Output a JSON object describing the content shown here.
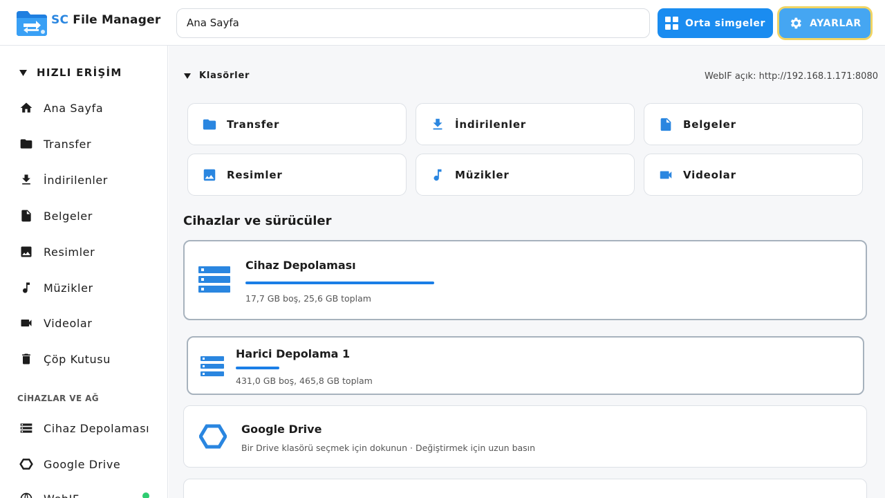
{
  "app": {
    "title_prefix": "SC",
    "title_rest": "File Manager"
  },
  "header": {
    "path": "Ana Sayfa",
    "view_button": "Orta simgeler",
    "settings_button": "AYARLAR"
  },
  "sidebar": {
    "quick_access_title": "HIZLI ERİŞİM",
    "items": [
      {
        "label": "Ana Sayfa",
        "icon": "home-icon"
      },
      {
        "label": "Transfer",
        "icon": "folder-icon"
      },
      {
        "label": "İndirilenler",
        "icon": "download-icon"
      },
      {
        "label": "Belgeler",
        "icon": "document-icon"
      },
      {
        "label": "Resimler",
        "icon": "image-icon"
      },
      {
        "label": "Müzikler",
        "icon": "music-icon"
      },
      {
        "label": "Videolar",
        "icon": "video-icon"
      },
      {
        "label": "Çöp Kutusu",
        "icon": "trash-icon"
      }
    ],
    "devices_title": "CİHAZLAR VE AĞ",
    "device_items": [
      {
        "label": "Cihaz Depolaması",
        "icon": "storage-icon"
      },
      {
        "label": "Google Drive",
        "icon": "drive-icon"
      },
      {
        "label": "WebIF",
        "icon": "globe-icon"
      }
    ]
  },
  "main": {
    "folders_title": "Klasörler",
    "webif_status": "WebIF açık: http://192.168.1.171:8080",
    "folders": [
      {
        "label": "Transfer",
        "icon": "folder-icon"
      },
      {
        "label": "İndirilenler",
        "icon": "download-icon"
      },
      {
        "label": "Belgeler",
        "icon": "document-icon"
      },
      {
        "label": "Resimler",
        "icon": "image-icon"
      },
      {
        "label": "Müzikler",
        "icon": "music-icon"
      },
      {
        "label": "Videolar",
        "icon": "video-icon"
      }
    ],
    "devices_title": "Cihazlar ve sürücüler",
    "drives": [
      {
        "name": "Cihaz Depolaması",
        "detail": "17,7 GB boş, 25,6 GB toplam",
        "used_fraction": 0.31
      },
      {
        "name": "Harici Depolama 1",
        "detail": "431,0 GB boş, 465,8 GB toplam",
        "used_fraction": 0.07
      },
      {
        "name": "Google Drive",
        "detail": "Bir Drive klasörü seçmek için dokunun · Değiştirmek için uzun basın"
      }
    ]
  },
  "colors": {
    "accent": "#1a8cf0",
    "focus": "#f0d463",
    "bar": "#1a7ee6"
  }
}
